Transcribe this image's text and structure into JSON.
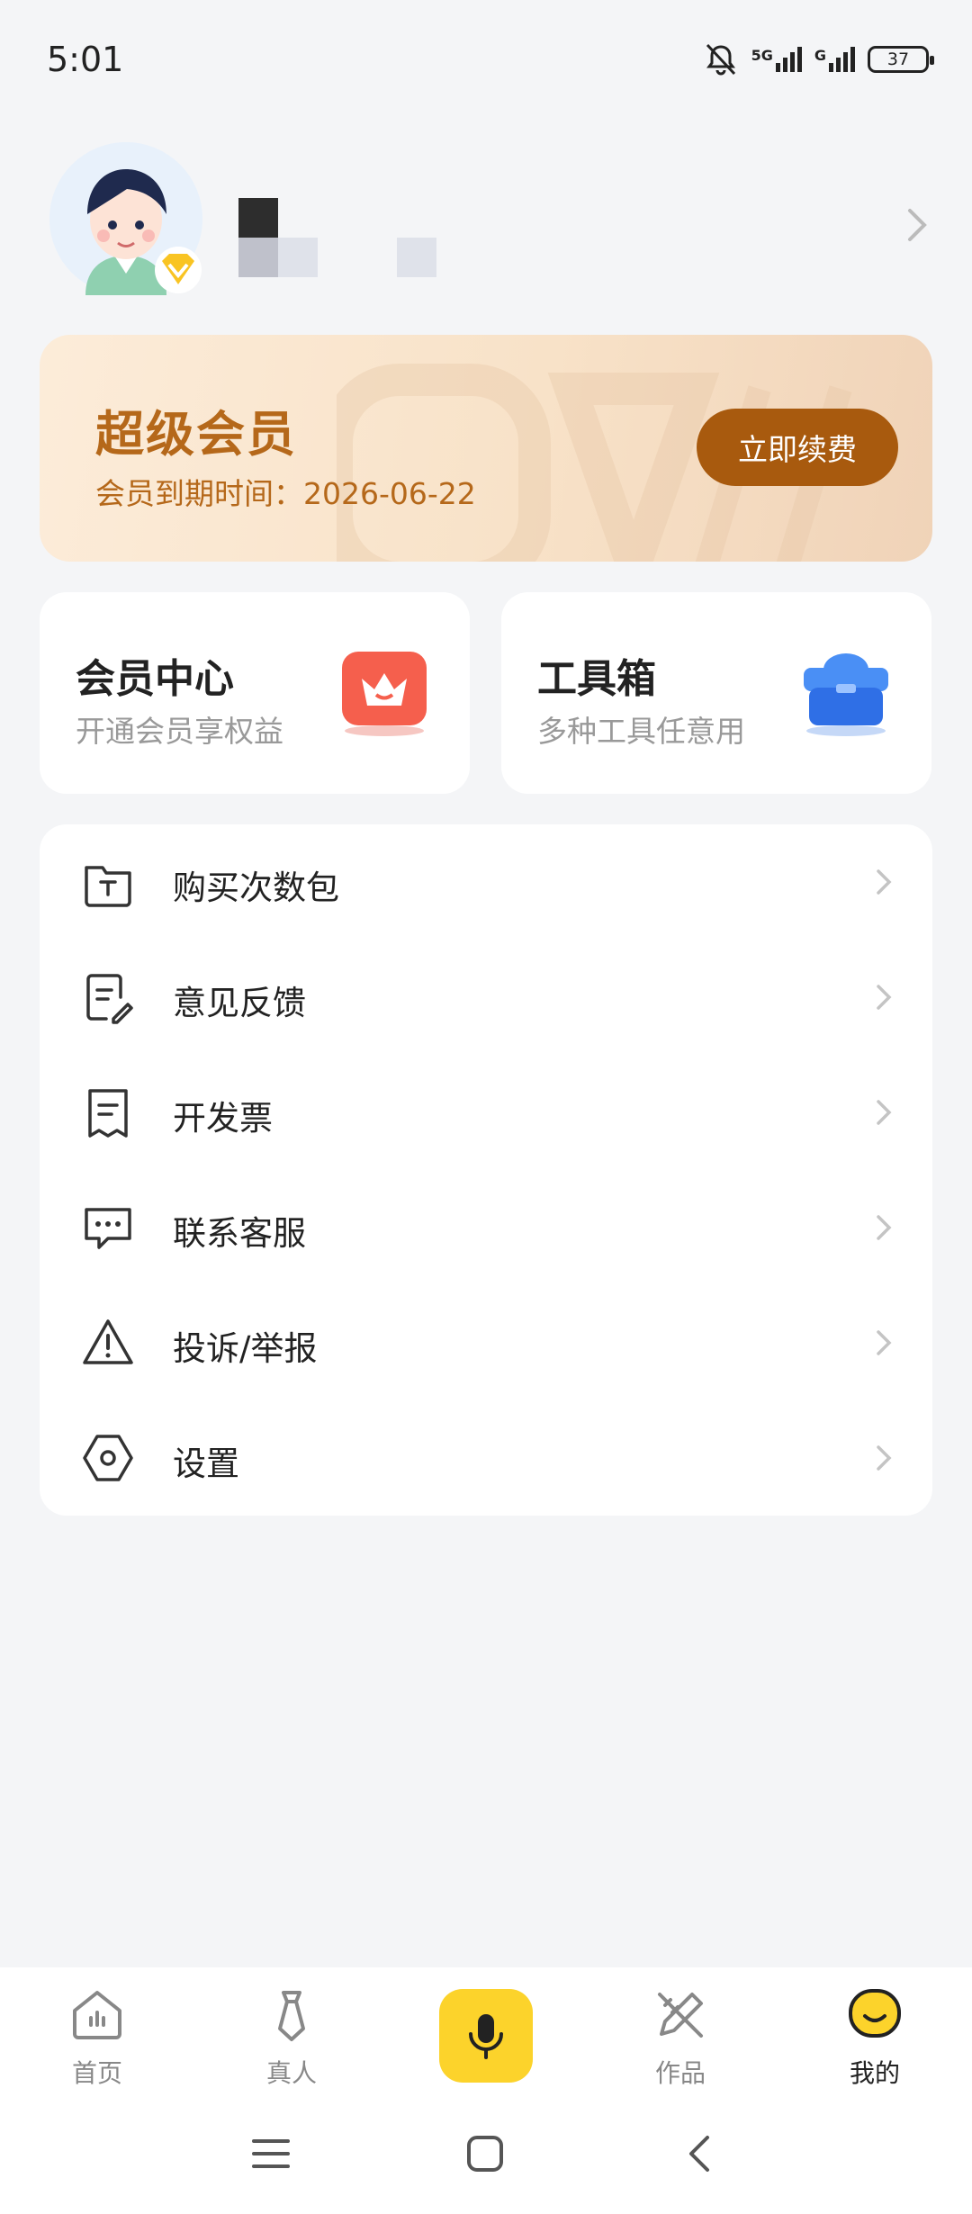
{
  "status_bar": {
    "time": "5:01",
    "battery": "37",
    "network_1": "5G",
    "network_2": "G"
  },
  "profile": {
    "icons": [
      "avatar",
      "vip-badge-icon",
      "chevron-right-icon"
    ]
  },
  "member_card": {
    "title": "超级会员",
    "expire_text": "会员到期时间：2026-06-22",
    "renew_button": "立即续费",
    "colors": {
      "title": "#b5681a",
      "button": "#a85a0e"
    }
  },
  "features": [
    {
      "title": "会员中心",
      "subtitle": "开通会员享权益",
      "icon": "crown-icon"
    },
    {
      "title": "工具箱",
      "subtitle": "多种工具任意用",
      "icon": "toolbox-icon"
    }
  ],
  "menu": {
    "items": [
      {
        "label": "购买次数包",
        "icon": "package-icon"
      },
      {
        "label": "意见反馈",
        "icon": "feedback-icon"
      },
      {
        "label": "开发票",
        "icon": "invoice-icon"
      },
      {
        "label": "联系客服",
        "icon": "chat-icon"
      },
      {
        "label": "投诉/举报",
        "icon": "warning-icon"
      },
      {
        "label": "设置",
        "icon": "settings-icon"
      }
    ]
  },
  "bottom_nav": {
    "items": [
      {
        "label": "首页",
        "icon": "home-icon"
      },
      {
        "label": "真人",
        "icon": "tie-icon"
      },
      {
        "label": "",
        "icon": "microphone-icon"
      },
      {
        "label": "作品",
        "icon": "pencil-ruler-icon"
      },
      {
        "label": "我的",
        "icon": "smile-icon",
        "active": true
      }
    ],
    "accent": "#fcd32b"
  }
}
